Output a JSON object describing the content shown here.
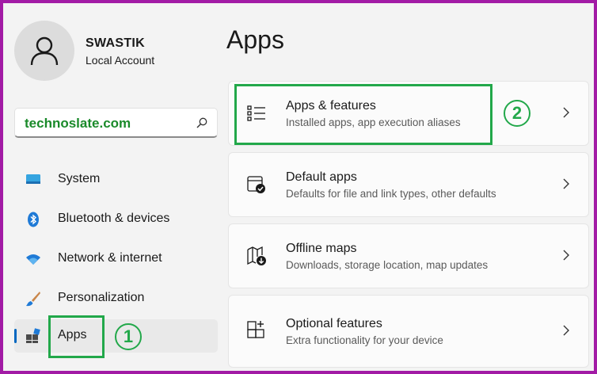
{
  "user": {
    "name": "SWASTIK",
    "account_type": "Local Account"
  },
  "search": {
    "value": "technoslate.com"
  },
  "nav": {
    "items": [
      {
        "label": "System",
        "icon": "monitor-icon"
      },
      {
        "label": "Bluetooth & devices",
        "icon": "bluetooth-icon"
      },
      {
        "label": "Network & internet",
        "icon": "wifi-icon"
      },
      {
        "label": "Personalization",
        "icon": "brush-icon"
      },
      {
        "label": "Apps",
        "icon": "apps-icon",
        "active": true
      }
    ]
  },
  "page": {
    "title": "Apps"
  },
  "cards": [
    {
      "title": "Apps & features",
      "subtitle": "Installed apps, app execution aliases",
      "icon": "list-icon"
    },
    {
      "title": "Default apps",
      "subtitle": "Defaults for file and link types, other defaults",
      "icon": "default-apps-icon"
    },
    {
      "title": "Offline maps",
      "subtitle": "Downloads, storage location, map updates",
      "icon": "map-icon"
    },
    {
      "title": "Optional features",
      "subtitle": "Extra functionality for your device",
      "icon": "optional-features-icon"
    }
  ],
  "annotations": {
    "step1": "1",
    "step2": "2"
  },
  "colors": {
    "frame": "#a21ba5",
    "highlight": "#22a84a",
    "accent": "#0067c0",
    "search_text": "#1a8a2a"
  }
}
